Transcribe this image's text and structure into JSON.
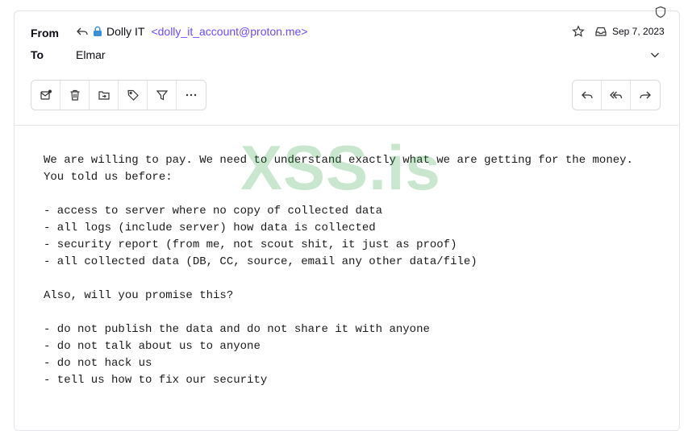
{
  "header": {
    "from_label": "From",
    "to_label": "To",
    "sender_name": "Dolly IT",
    "sender_address": "<dolly_it_account@proton.me>",
    "recipient": "Elmar",
    "date": "Sep 7, 2023",
    "accent_color": "#6d4aff"
  },
  "icons": {
    "shield": "shield-icon",
    "replied": "reply-arrow-icon",
    "lock": "lock-icon",
    "star": "star-icon",
    "inbox": "inbox-icon",
    "expand": "chevron-down-icon"
  },
  "toolbar_left": [
    "mark-unread-icon",
    "trash-icon",
    "move-icon",
    "label-icon",
    "filter-icon",
    "more-icon"
  ],
  "toolbar_right": [
    "reply-icon",
    "reply-all-icon",
    "forward-icon"
  ],
  "watermark": "XSS.is",
  "message": {
    "body": "We are willing to pay. We need to understand exactly what we are getting for the money. You told us before:\n\n- access to server where no copy of collected data\n- all logs (include server) how data is collected\n- security report (from me, not scout shit, it just as proof)\n- all collected data (DB, CC, source, email any other data/file)\n\nAlso, will you promise this?\n\n- do not publish the data and do not share it with anyone\n- do not talk about us to anyone\n- do not hack us\n- tell us how to fix our security"
  }
}
